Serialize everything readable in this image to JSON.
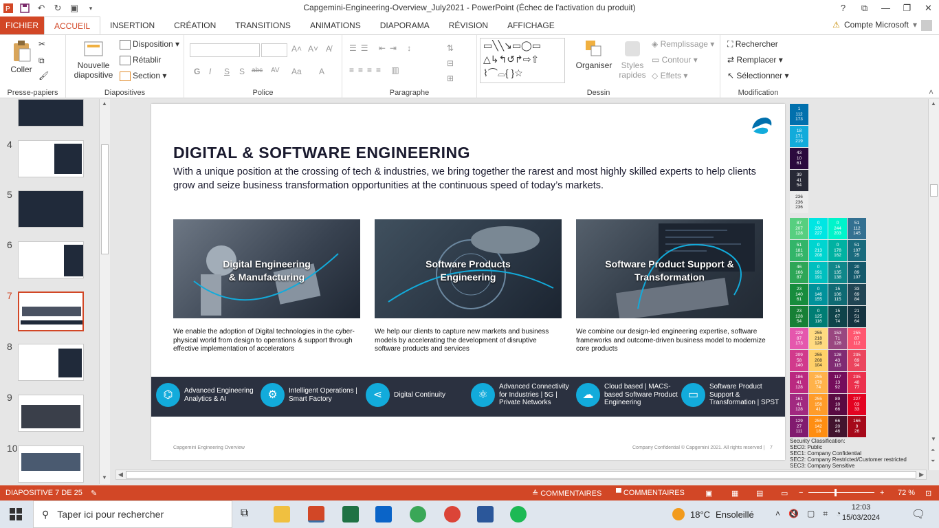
{
  "window": {
    "title": "Capgemini-Engineering-Overview_July2021 - PowerPoint (Échec de l'activation du produit)",
    "controls": [
      "?",
      "⧉",
      "—",
      "❐",
      "✕"
    ]
  },
  "quick_access": [
    "save-icon",
    "undo-icon",
    "redo-icon",
    "present-icon"
  ],
  "tabs": [
    "FICHIER",
    "ACCUEIL",
    "INSERTION",
    "CRÉATION",
    "TRANSITIONS",
    "ANIMATIONS",
    "DIAPORAMA",
    "RÉVISION",
    "AFFICHAGE"
  ],
  "active_tab": "ACCUEIL",
  "account": {
    "warning": "⚠",
    "label": "Compte Microsoft"
  },
  "ribbon": {
    "clipboard": {
      "label": "Presse-papiers",
      "paste": "Coller"
    },
    "slides": {
      "label": "Diapositives",
      "new_slide_1": "Nouvelle",
      "new_slide_2": "diapositive",
      "layout": "Disposition",
      "reset": "Rétablir",
      "section": "Section"
    },
    "font": {
      "label": "Police",
      "buttons": [
        "G",
        "I",
        "S",
        "S",
        "abc",
        "AV",
        "Aa",
        "A"
      ]
    },
    "paragraph": {
      "label": "Paragraphe"
    },
    "drawing": {
      "label": "Dessin",
      "arrange": "Organiser",
      "styles_1": "Styles",
      "styles_2": "rapides",
      "fill": "Remplissage",
      "outline": "Contour",
      "effects": "Effets"
    },
    "editing": {
      "label": "Modification",
      "find": "Rechercher",
      "replace": "Remplacer",
      "select": "Sélectionner"
    }
  },
  "thumbnails": [
    {
      "num": "4"
    },
    {
      "num": "5"
    },
    {
      "num": "6"
    },
    {
      "num": "7",
      "selected": true
    },
    {
      "num": "8"
    },
    {
      "num": "9"
    },
    {
      "num": "10"
    }
  ],
  "slide": {
    "title": "DIGITAL & SOFTWARE ENGINEERING",
    "subtitle": "With a unique position at the crossing of tech & industries, we bring together the rarest and most highly skilled experts to help clients grow and seize business transformation opportunities at the continuous speed of today’s markets.",
    "cards": [
      {
        "title1": "Digital Engineering",
        "title2": "& Manufacturing",
        "desc": "We enable the adoption of Digital technologies in the cyber-physical world from design to operations & support through effective implementation of accelerators"
      },
      {
        "title1": "Software Products",
        "title2": "Engineering",
        "desc": "We help our clients to capture new markets and business models by accelerating the development of disruptive software products and services"
      },
      {
        "title1": "Software Product Support &",
        "title2": "Transformation",
        "desc": "We combine our design-led engineering expertise, software frameworks and outcome-driven business model to modernize core products"
      }
    ],
    "band": [
      {
        "icon": "data-icon",
        "text": "Advanced Engineering Analytics & AI"
      },
      {
        "icon": "gears-icon",
        "text": "Intelligent Operations | Smart Factory"
      },
      {
        "icon": "share-icon",
        "text": "Digital Continuity"
      },
      {
        "icon": "atom-icon",
        "text": "Advanced Connectivity for Industries | 5G | Private Networks"
      },
      {
        "icon": "cloud-icon",
        "text": "Cloud based | MACS-based Software Product Engineering"
      },
      {
        "icon": "laptop-icon",
        "text": "Software Product Support & Transformation | SPST"
      }
    ],
    "footer_left": "Capgemini Engineering Overview",
    "footer_right": "Company Confidential © Capgemini 2021. All rights reserved |",
    "page_num": "7"
  },
  "palette": [
    {
      "col": 0,
      "row": 0,
      "t": "1\n112\n173",
      "c": "#0170ad"
    },
    {
      "col": 0,
      "row": 1,
      "t": "18\n171\n219",
      "c": "#12abdb"
    },
    {
      "col": 0,
      "row": 2,
      "t": "43\n10\n61",
      "c": "#2b0a3d"
    },
    {
      "col": 0,
      "row": 3,
      "t": "39\n41\n54",
      "c": "#272936"
    },
    {
      "col": 0,
      "row": 4,
      "t": "236\n236\n236",
      "c": "#ececec",
      "dark": true
    },
    {
      "col": 0,
      "row": 5,
      "t": "87\n207\n128",
      "c": "#57cf80"
    },
    {
      "col": 1,
      "row": 5,
      "t": "0\n230\n227",
      "c": "#00e6e3"
    },
    {
      "col": 2,
      "row": 5,
      "t": "0\n244\n203",
      "c": "#00f4cb"
    },
    {
      "col": 3,
      "row": 5,
      "t": "51\n112\n145",
      "c": "#337091"
    },
    {
      "col": 0,
      "row": 6,
      "t": "51\n181\n105",
      "c": "#33b569"
    },
    {
      "col": 1,
      "row": 6,
      "t": "0\n213\n208",
      "c": "#00d5d0"
    },
    {
      "col": 2,
      "row": 6,
      "t": "0\n178\n162",
      "c": "#00b2a2"
    },
    {
      "col": 3,
      "row": 6,
      "t": "51\n107\n25",
      "c": "#196b7d"
    },
    {
      "col": 0,
      "row": 7,
      "t": "46\n166\n87",
      "c": "#2ea657"
    },
    {
      "col": 1,
      "row": 7,
      "t": "0\n191\n191",
      "c": "#00bfbf"
    },
    {
      "col": 2,
      "row": 7,
      "t": "15\n135\n138",
      "c": "#0f878a"
    },
    {
      "col": 3,
      "row": 7,
      "t": "20\n89\n107",
      "c": "#14596b"
    },
    {
      "col": 0,
      "row": 8,
      "t": "23\n140\n61",
      "c": "#178c3d"
    },
    {
      "col": 1,
      "row": 8,
      "t": "0\n146\n155",
      "c": "#00929b"
    },
    {
      "col": 2,
      "row": 8,
      "t": "15\n106\n115",
      "c": "#0f6a73"
    },
    {
      "col": 3,
      "row": 8,
      "t": "33\n69\n84",
      "c": "#214554"
    },
    {
      "col": 0,
      "row": 9,
      "t": "23\n128\n54",
      "c": "#178036"
    },
    {
      "col": 1,
      "row": 9,
      "t": "0\n125\n116",
      "c": "#007d74"
    },
    {
      "col": 2,
      "row": 9,
      "t": "15\n67\n74",
      "c": "#0f434a"
    },
    {
      "col": 3,
      "row": 9,
      "t": "21\n51\n64",
      "c": "#153340"
    },
    {
      "col": 0,
      "row": 10,
      "t": "229\n87\n173",
      "c": "#e557ad"
    },
    {
      "col": 1,
      "row": 10,
      "t": "255\n218\n128",
      "c": "#ffda80",
      "dark": true
    },
    {
      "col": 2,
      "row": 10,
      "t": "153\n71\n128",
      "c": "#994780"
    },
    {
      "col": 3,
      "row": 10,
      "t": "255\n87\n112",
      "c": "#ff5770"
    },
    {
      "col": 0,
      "row": 11,
      "t": "209\n58\n140",
      "c": "#d13a8c"
    },
    {
      "col": 1,
      "row": 11,
      "t": "255\n208\n104",
      "c": "#ffd068",
      "dark": true
    },
    {
      "col": 2,
      "row": 11,
      "t": "128\n43\n115",
      "c": "#802b73"
    },
    {
      "col": 3,
      "row": 11,
      "t": "235\n69\n94",
      "c": "#eb455e"
    },
    {
      "col": 0,
      "row": 12,
      "t": "186\n41\n128",
      "c": "#ba2980"
    },
    {
      "col": 1,
      "row": 12,
      "t": "255\n178\n74",
      "c": "#ffb24a"
    },
    {
      "col": 2,
      "row": 12,
      "t": "117\n13\n92",
      "c": "#750d5c"
    },
    {
      "col": 3,
      "row": 12,
      "t": "235\n48\n77",
      "c": "#eb304d"
    },
    {
      "col": 0,
      "row": 13,
      "t": "161\n41\n128",
      "c": "#a12980"
    },
    {
      "col": 1,
      "row": 13,
      "t": "255\n156\n41",
      "c": "#ff9c29"
    },
    {
      "col": 2,
      "row": 13,
      "t": "89\n10\n66",
      "c": "#590a42"
    },
    {
      "col": 3,
      "row": 13,
      "t": "227\n03\n33",
      "c": "#e30321"
    },
    {
      "col": 0,
      "row": 14,
      "t": "129\n27\n111",
      "c": "#811b6f"
    },
    {
      "col": 1,
      "row": 14,
      "t": "255\n142\n18",
      "c": "#ff8e12"
    },
    {
      "col": 2,
      "row": 14,
      "t": "66\n20\n46",
      "c": "#42142e"
    },
    {
      "col": 3,
      "row": 14,
      "t": "166\n9\n26",
      "c": "#a6091a"
    }
  ],
  "security": [
    "Security Classification:",
    "SEC0: Public",
    "SEC1: Company Confidential",
    "SEC2: Company Restricted/Customer restricted",
    "SEC3: Company Sensitive"
  ],
  "status": {
    "slide": "DIAPOSITIVE 7 DE 25",
    "notes": "COMMENTAIRES",
    "comments": "COMMENTAIRES",
    "zoom": "72 %"
  },
  "taskbar": {
    "search": "Taper ici pour rechercher",
    "temp": "18°C",
    "weather": "Ensoleillé",
    "time": "12:03",
    "date": "15/03/2024"
  }
}
